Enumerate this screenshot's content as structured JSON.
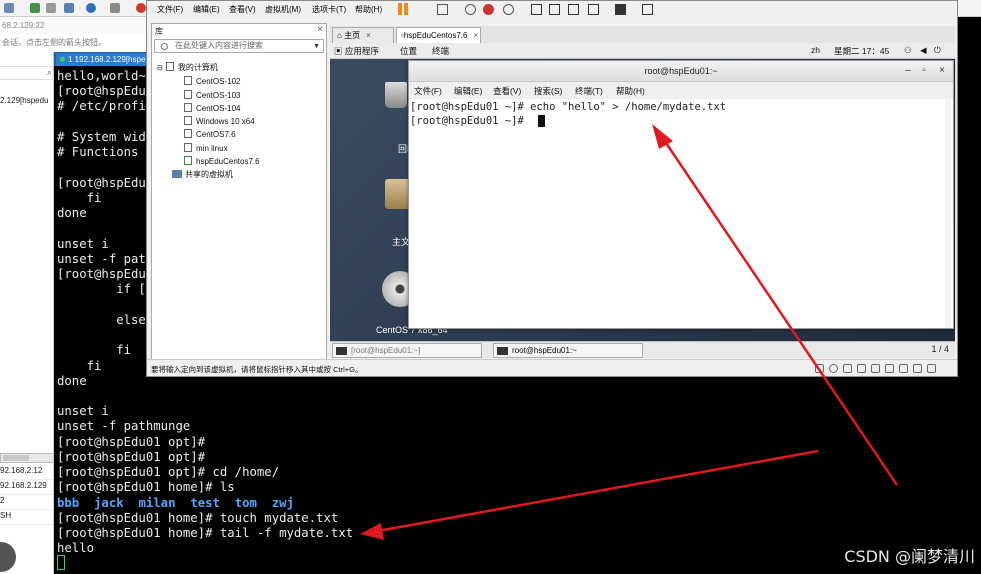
{
  "background": {
    "address_strip": "68.2.129:22",
    "hint_strip": "会话，点击左侧的箭头按钮。",
    "left_host": "2.129[hspedu",
    "left_props": [
      "92.168.2.12",
      "92.168.2.129",
      "2",
      "SH"
    ],
    "tab_label": "1 192.168.2.129[hspe"
  },
  "terminal": {
    "lines": [
      "hello,world~",
      "[root@hspEdu",
      "# /etc/profi",
      "",
      "# System wid",
      "# Functions ",
      "",
      "[root@hspEdu",
      "    fi",
      "done",
      "",
      "unset i",
      "unset -f pat",
      "[root@hspEdu",
      "        if [",
      "",
      "        else",
      "",
      "        fi",
      "    fi",
      "done",
      "",
      "unset i",
      "unset -f pathmunge",
      "[root@hspEdu01 opt]#",
      "[root@hspEdu01 opt]#",
      "[root@hspEdu01 opt]# cd /home/",
      "[root@hspEdu01 home]# ls",
      "",
      "[root@hspEdu01 home]# touch mydate.txt",
      "[root@hspEdu01 home]# tail -f mydate.txt",
      "hello"
    ],
    "ls_dirs": [
      "bbb",
      "jack",
      "milan",
      "test",
      "tom",
      "zwj"
    ],
    "colors": {
      "directory": "#4fa6ff",
      "cursor": "#3bd34b"
    }
  },
  "watermark": "CSDN @阑梦清川",
  "vmware": {
    "menu": [
      "文件(F)",
      "编辑(E)",
      "查看(V)",
      "虚拟机(M)",
      "选项卡(T)",
      "帮助(H)"
    ],
    "library": {
      "title": "库",
      "close": "×",
      "search_placeholder": "在此处键入内容进行搜索",
      "root": "我的计算机",
      "vms": [
        "CentOS-102",
        "CentOS-103",
        "CentOS-104",
        "Windows 10 x64",
        "CentOS7.6",
        "min linux",
        "hspEduCentos7.6"
      ],
      "shared": "共享的虚拟机"
    },
    "tabs": [
      {
        "label": "主页",
        "active": false
      },
      {
        "label": "hspEduCentos7.6",
        "active": true
      }
    ],
    "tab_close": "×",
    "gnome": {
      "apps": "应用程序",
      "places": "位置",
      "terminal": "终端",
      "lang": "zh",
      "clock": "星期二 17：45"
    },
    "desktop_labels": {
      "trash": "回收",
      "home": "主文",
      "disc": "CentOS 7 x86_64"
    },
    "taskbar": {
      "items": [
        "[root@hspEdu01:~]",
        "root@hspEdu01:~"
      ],
      "pager": "1 / 4"
    },
    "status_text": "要将输入定向到该虚拟机，请将鼠标指针移入其中或按 Ctrl+G。"
  },
  "guest_terminal": {
    "title": "root@hspEdu01:~",
    "controls": [
      "–",
      "▫",
      "×"
    ],
    "menu": [
      "文件(F)",
      "编辑(E)",
      "查看(V)",
      "搜索(S)",
      "终端(T)",
      "帮助(H)"
    ],
    "lines": [
      "[root@hspEdu01 ~]# echo \"hello\" > /home/mydate.txt",
      "[root@hspEdu01 ~]# "
    ]
  },
  "annotation": {
    "arrow_color": "#e0191f"
  }
}
